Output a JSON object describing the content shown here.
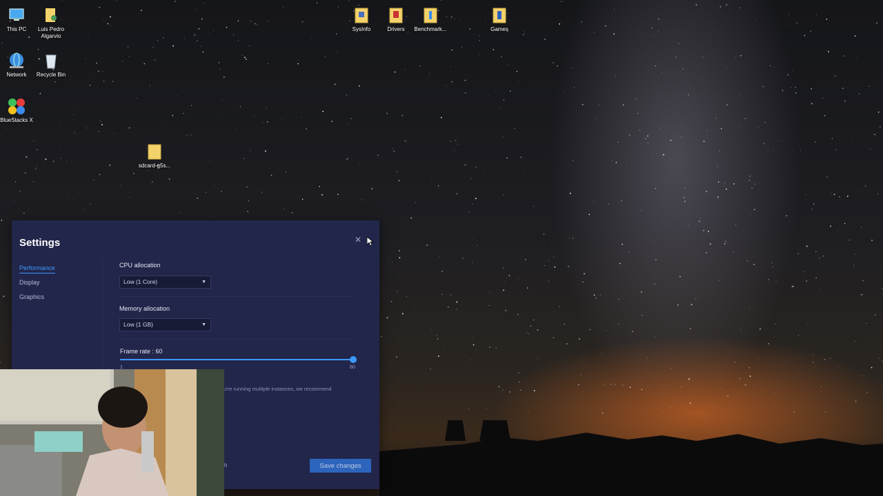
{
  "desktop": {
    "icons": [
      {
        "label": "This PC",
        "icon": "monitor-icon"
      },
      {
        "label": "Luis Pedro Algarvio",
        "icon": "user-folder-icon"
      },
      {
        "label": "Network",
        "icon": "network-globe-icon"
      },
      {
        "label": "Recycle Bin",
        "icon": "recycle-bin-icon"
      },
      {
        "label": "BlueStacks X",
        "icon": "bluestacks-icon"
      },
      {
        "label": "sdcard-g5s...",
        "icon": "folder-icon"
      },
      {
        "label": "SysInfo",
        "icon": "folder-icon"
      },
      {
        "label": "Drivers",
        "icon": "folder-icon"
      },
      {
        "label": "Benchmark...",
        "icon": "folder-icon"
      },
      {
        "label": "Games",
        "icon": "folder-icon"
      }
    ]
  },
  "settings": {
    "title": "Settings",
    "close_icon": "close-icon",
    "nav": [
      {
        "label": "Performance",
        "active": true
      },
      {
        "label": "Display",
        "active": false
      },
      {
        "label": "Graphics",
        "active": false
      }
    ],
    "cpu": {
      "label": "CPU allocation",
      "value": "Low (1 Core)"
    },
    "memory": {
      "label": "Memory allocation",
      "value": "Low (1 GB)"
    },
    "frame_rate": {
      "label": "Frame rate : 60",
      "min": "1",
      "max": "60",
      "value": 60
    },
    "hint_text": "u're running multiple instances, we recommend",
    "partial_text": "h",
    "save_label": "Save changes",
    "accent": "#3d98ff"
  }
}
